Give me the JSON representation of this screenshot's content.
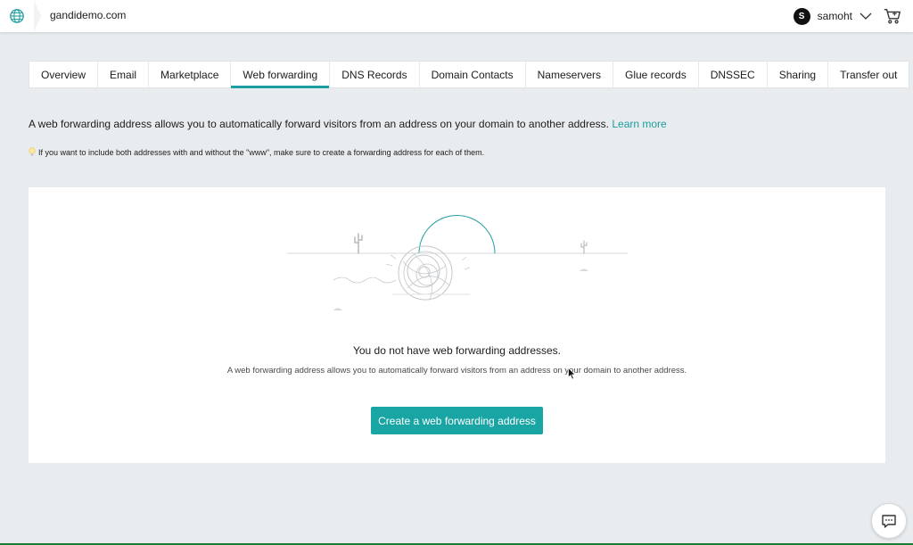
{
  "header": {
    "domain": "gandidemo.com",
    "user_initial": "S",
    "username": "samoht",
    "icons": [
      "globe-icon",
      "chevron-down-icon",
      "cart-icon"
    ]
  },
  "tabs": [
    {
      "label": "Overview"
    },
    {
      "label": "Email"
    },
    {
      "label": "Marketplace"
    },
    {
      "label": "Web forwarding",
      "active": true
    },
    {
      "label": "DNS Records"
    },
    {
      "label": "Domain Contacts"
    },
    {
      "label": "Nameservers"
    },
    {
      "label": "Glue records"
    },
    {
      "label": "DNSSEC"
    },
    {
      "label": "Sharing"
    },
    {
      "label": "Transfer out"
    }
  ],
  "intro": {
    "text": "A web forwarding address allows you to automatically forward visitors from an address on your domain to another address.",
    "link": "Learn more"
  },
  "hint": {
    "icon": "lightbulb-icon",
    "text": "If you want to include both addresses with and without the \"www\", make sure to create a forwarding address for each of them."
  },
  "empty_state": {
    "illustration": "desert-tumbleweed-illustration",
    "title": "You do not have web forwarding addresses.",
    "description": "A web forwarding address allows you to automatically forward visitors from an address on your domain to another address.",
    "button": "Create a web forwarding address"
  },
  "chat": {
    "icon": "chat-icon"
  },
  "colors": {
    "accent": "#1aa5a5",
    "background": "#e9ecee",
    "panel": "#ffffff"
  }
}
